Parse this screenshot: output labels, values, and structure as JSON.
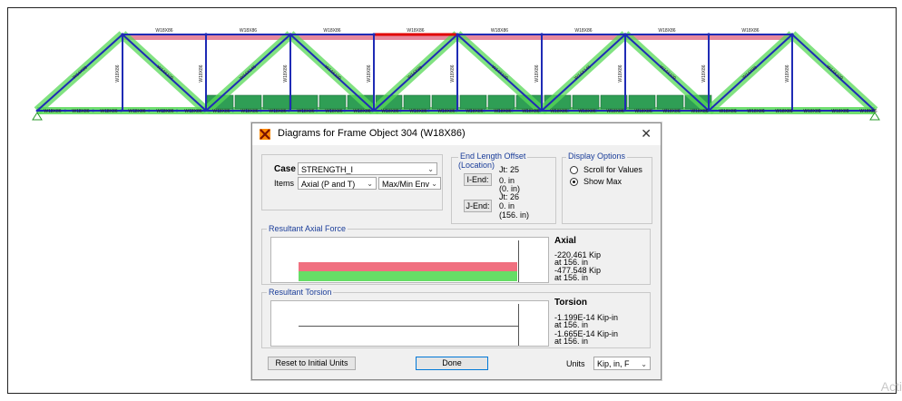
{
  "truss": {
    "member_label": "W18X86",
    "diagonal_labels": [
      "W14X99",
      "W14X109",
      "W14X145"
    ],
    "vertical_labels": [
      "W18X86",
      "W18X86",
      "W18X86",
      "W18X86",
      "W18X86",
      "W18X86",
      "W18X86",
      "W18X86",
      "W18X86"
    ],
    "colors": {
      "frame": "#1f2bb5",
      "compression": "#57d957",
      "tension": "#e06a84",
      "selected": "#e00000",
      "green_block": "#2f9e55"
    }
  },
  "dialog": {
    "title": "Diagrams for Frame Object 304  (W18X86)",
    "case_label": "Case",
    "case_value": "STRENGTH_I",
    "items_label": "Items",
    "items_value": "Axial (P and T)",
    "env_value": "Max/Min Env",
    "end_offset": {
      "title": "End Length Offset",
      "subtitle": "(Location)",
      "jt_i": "Jt:  25",
      "i_end_label": "I-End:",
      "i_val": "0. in",
      "i_loc": "(0. in)",
      "jt_j": "Jt:  26",
      "j_end_label": "J-End:",
      "j_val": "0. in",
      "j_loc": "(156. in)"
    },
    "display_options": {
      "title": "Display Options",
      "scroll_label": "Scroll for Values",
      "showmax_label": "Show Max",
      "selected": "Show Max"
    },
    "axial": {
      "group_title": "Resultant Axial Force",
      "heading": "Axial",
      "v1": "-220.461 Kip",
      "v1_loc": "at 156. in",
      "v2": "-477.548 Kip",
      "v2_loc": "at 156. in",
      "values_kip": [
        -220.461,
        -477.548
      ]
    },
    "torsion": {
      "group_title": "Resultant Torsion",
      "heading": "Torsion",
      "v1": "-1.199E-14 Kip-in",
      "v1_loc": "at 156. in",
      "v2": "-1.665E-14 Kip-in",
      "v2_loc": "at 156. in"
    },
    "reset_label": "Reset to Initial Units",
    "done_label": "Done",
    "units_label": "Units",
    "units_value": "Kip, in, F"
  },
  "watermark": "Acti"
}
